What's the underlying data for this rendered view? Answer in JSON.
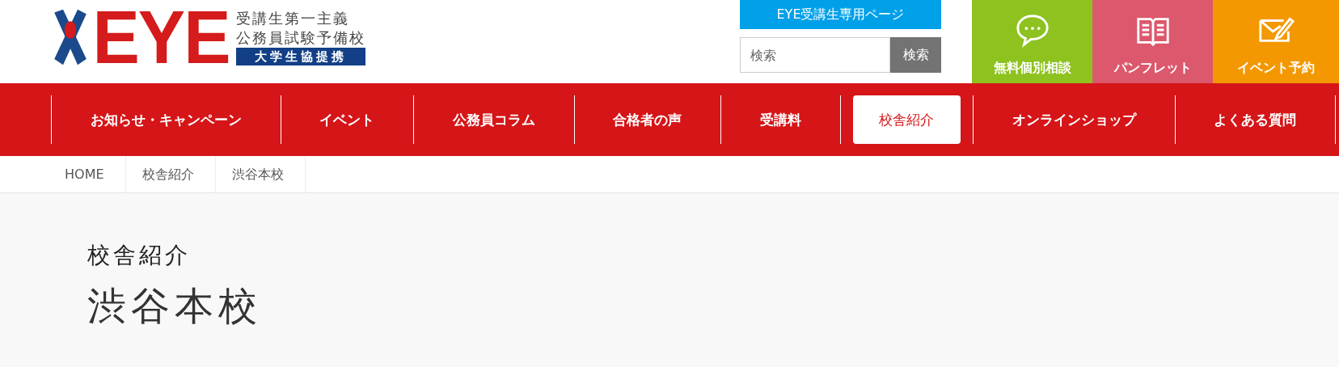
{
  "logo": {
    "wordmark": "EYE",
    "taglines": [
      "受講生第一主義",
      "公務員試験予備校"
    ],
    "badge": "大学生協提携"
  },
  "member_link": "EYE受講生専用ページ",
  "search": {
    "placeholder": "検索",
    "button": "検索"
  },
  "quick_links": [
    {
      "kind": "chat",
      "label": "無料個別相談",
      "color": "#8dc21f"
    },
    {
      "kind": "book",
      "label": "パンフレット",
      "color": "#dc586d"
    },
    {
      "kind": "mail",
      "label": "イベント予約",
      "color": "#f39800"
    }
  ],
  "nav": [
    {
      "label": "お知らせ・キャンペーン",
      "selected": false
    },
    {
      "label": "イベント",
      "selected": false
    },
    {
      "label": "公務員コラム",
      "selected": false
    },
    {
      "label": "合格者の声",
      "selected": false
    },
    {
      "label": "受講料",
      "selected": false
    },
    {
      "label": "校舎紹介",
      "selected": true
    },
    {
      "label": "オンラインショップ",
      "selected": false
    },
    {
      "label": "よくある質問",
      "selected": false
    }
  ],
  "breadcrumb": [
    "HOME",
    "校舎紹介",
    "渋谷本校"
  ],
  "page": {
    "category": "校舎紹介",
    "title": "渋谷本校"
  }
}
